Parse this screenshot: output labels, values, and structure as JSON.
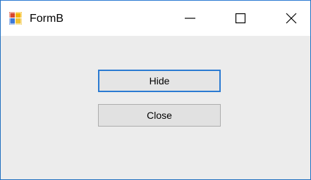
{
  "window": {
    "title": "FormB",
    "icon": "windows-form-icon"
  },
  "controls": {
    "minimize_icon": "minimize-icon",
    "maximize_icon": "maximize-icon",
    "close_icon": "close-icon"
  },
  "buttons": {
    "hide_label": "Hide",
    "close_label": "Close"
  },
  "colors": {
    "window_border": "#2a7ad2",
    "client_background": "#ececec",
    "button_background": "#e1e1e1",
    "focused_button_border": "#2a7ad2"
  }
}
